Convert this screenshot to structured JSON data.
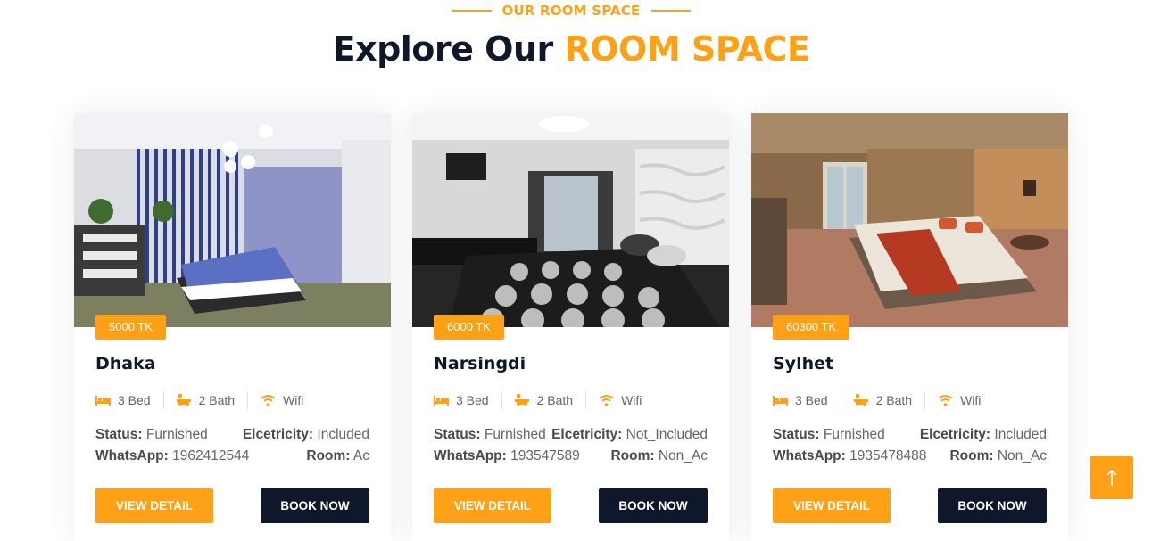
{
  "section": {
    "tag": "OUR ROOM SPACE",
    "title_prefix": "Explore Our",
    "title_accent": "ROOM SPACE"
  },
  "colors": {
    "accent": "#fea116",
    "dark": "#0f172b",
    "text": "#666565"
  },
  "rooms": [
    {
      "price": "5000 TK",
      "name": "Dhaka",
      "bed": "3 Bed",
      "bath": "2 Bath",
      "wifi": "Wifi",
      "status_label": "Status:",
      "status_value": "Furnished",
      "electricity_label": "Elcetricity:",
      "electricity_value": "Included",
      "whatsapp_label": "WhatsApp:",
      "whatsapp_value": "1962412544",
      "room_label": "Room:",
      "room_value": "Ac",
      "view_label": "VIEW DETAIL",
      "book_label": "BOOK NOW"
    },
    {
      "price": "6000 TK",
      "name": "Narsingdi",
      "bed": "3 Bed",
      "bath": "2 Bath",
      "wifi": "Wifi",
      "status_label": "Status:",
      "status_value": "Furnished",
      "electricity_label": "Elcetricity:",
      "electricity_value": "Not_Included",
      "whatsapp_label": "WhatsApp:",
      "whatsapp_value": "193547589",
      "room_label": "Room:",
      "room_value": "Non_Ac",
      "view_label": "VIEW DETAIL",
      "book_label": "BOOK NOW"
    },
    {
      "price": "60300 TK",
      "name": "Sylhet",
      "bed": "3 Bed",
      "bath": "2 Bath",
      "wifi": "Wifi",
      "status_label": "Status:",
      "status_value": "Furnished",
      "electricity_label": "Elcetricity:",
      "electricity_value": "Included",
      "whatsapp_label": "WhatsApp:",
      "whatsapp_value": "1935478488",
      "room_label": "Room:",
      "room_value": "Non_Ac",
      "view_label": "VIEW DETAIL",
      "book_label": "BOOK NOW"
    }
  ],
  "icons": {
    "bed": "bed-icon",
    "bath": "bath-icon",
    "wifi": "wifi-icon",
    "back_to_top": "arrow-up-icon"
  }
}
